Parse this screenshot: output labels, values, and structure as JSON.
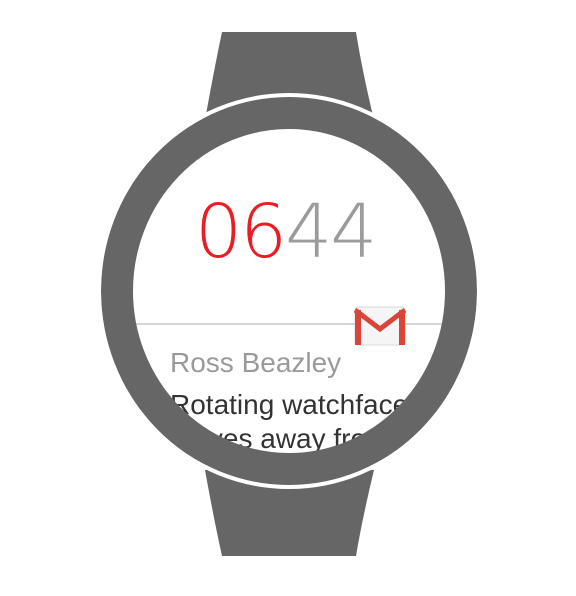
{
  "watch": {
    "time_hours": "06",
    "time_minutes": "44",
    "notification": {
      "app_icon": "gmail-icon",
      "sender": "Ross Beazley",
      "preview": "Rotating watchface moves away from"
    }
  },
  "colors": {
    "hours": "#ec1c24",
    "minutes": "#9b9b9b",
    "bezel": "#666666",
    "strap": "#666666",
    "gmail_red": "#db4437"
  }
}
